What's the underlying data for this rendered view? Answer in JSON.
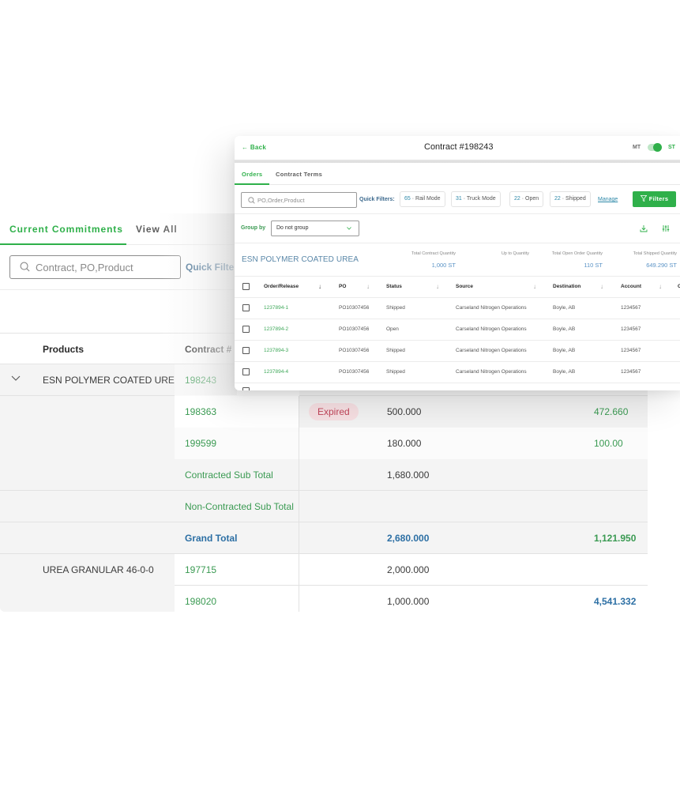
{
  "commitments": {
    "tabs": [
      {
        "label": "Current Commitments",
        "active": true
      },
      {
        "label": "View All",
        "active": false
      }
    ],
    "search": {
      "placeholder": "Contract, PO,Product",
      "value": ""
    },
    "quick_filters_label": "Quick Filters",
    "table": {
      "headers": {
        "products": "Products",
        "contract": "Contract #"
      },
      "rows": [
        {
          "product": "ESN POLYMER COATED UREA",
          "expand_icon": "chevron-down-icon",
          "contract": "198243",
          "status": "",
          "quantity": "",
          "shipped": ""
        },
        {
          "product": "",
          "contract": "198363",
          "status": "Expired",
          "quantity": "500.000",
          "shipped": "472.660"
        },
        {
          "product": "",
          "contract": "199599",
          "status": "",
          "quantity": "180.000",
          "shipped": "100.00"
        },
        {
          "product": "",
          "contract": "Contracted Sub Total",
          "status": "",
          "quantity": "1,680.000",
          "shipped": ""
        },
        {
          "product": "",
          "contract": "Non-Contracted Sub Total",
          "status": "",
          "quantity": "",
          "shipped": ""
        },
        {
          "product": "",
          "contract": "Grand Total",
          "status": "",
          "quantity": "2,680.000",
          "shipped": "1,121.950"
        },
        {
          "product": "UREA GRANULAR 46-0-0",
          "contract": "197715",
          "status": "",
          "quantity": "2,000.000",
          "shipped": ""
        },
        {
          "product": "",
          "contract": "198020",
          "status": "",
          "quantity": "1,000.000",
          "shipped": "4,541.332"
        }
      ]
    }
  },
  "contract_detail": {
    "back_label": "Back",
    "title": "Contract #198243",
    "unit_toggle": {
      "left": "MT",
      "right": "ST",
      "selected": "ST"
    },
    "tabs": [
      {
        "label": "Orders",
        "active": true
      },
      {
        "label": "Contract Terms",
        "active": false
      }
    ],
    "search": {
      "placeholder": "PO,Order,Product",
      "value": ""
    },
    "quick_filters_label": "Quick Filters:",
    "quick_filters": [
      {
        "count": "65",
        "label": "Rail Mode"
      },
      {
        "count": "31",
        "label": "Truck Mode"
      },
      {
        "count": "22",
        "label": "Open"
      },
      {
        "count": "22",
        "label": "Shipped"
      }
    ],
    "manage_label": "Manage",
    "filters_label": "Filters",
    "group_by": {
      "label": "Group by",
      "selected": "Do not group"
    },
    "product_name": "ESN POLYMER COATED UREA",
    "stats": [
      {
        "label": "Total Contract Quantity",
        "value": "1,000 ST"
      },
      {
        "label": "Up to Quantity",
        "value": ""
      },
      {
        "label": "Total Open Order Quantity",
        "value": "110 ST"
      },
      {
        "label": "Total Shipped Quantity",
        "value": "649.290 ST"
      }
    ],
    "columns": [
      "Order/Release",
      "PO",
      "Status",
      "Source",
      "Destination",
      "Account"
    ],
    "orders": [
      {
        "order": "1237894-1",
        "po": "PO10307456",
        "status": "Shipped",
        "source": "Carseland Nitrogen Operations",
        "destination": "Boyle, AB",
        "account": "1234567"
      },
      {
        "order": "1237894-2",
        "po": "PO10307456",
        "status": "Open",
        "source": "Carseland Nitrogen Operations",
        "destination": "Boyle, AB",
        "account": "1234567"
      },
      {
        "order": "1237894-3",
        "po": "PO10307456",
        "status": "Shipped",
        "source": "Carseland Nitrogen Operations",
        "destination": "Boyle, AB",
        "account": "1234567"
      },
      {
        "order": "1237894-4",
        "po": "PO10307456",
        "status": "Shipped",
        "source": "Carseland Nitrogen Operations",
        "destination": "Boyle, AB",
        "account": "1234567"
      }
    ]
  },
  "colors": {
    "brand_green": "#2fb04a",
    "link_green": "#3a9a52",
    "total_blue": "#2c6fa4",
    "expired_bg": "#f6dfe2",
    "expired_text": "#c2455a"
  }
}
